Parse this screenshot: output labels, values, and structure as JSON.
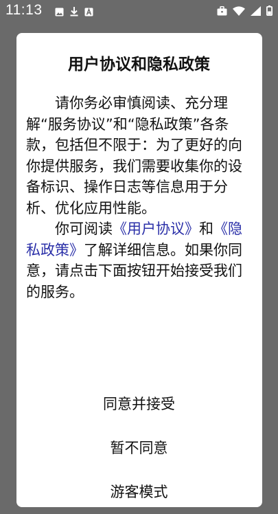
{
  "status_bar": {
    "time": "11:13",
    "notification_icons": [
      "image-icon",
      "download-icon",
      "a-badge-icon"
    ],
    "system_icons": [
      "briefcase-icon",
      "wifi-icon",
      "signal-icon",
      "battery-icon"
    ]
  },
  "dialog": {
    "title": "用户协议和隐私政策",
    "paragraph1": "请你务必审慎阅读、充分理解“服务协议”和“隐私政策”各条款，包括但不限于：为了更好的向你提供服务，我们需要收集你的设备标识、操作日志等信息用于分析、优化应用性能。",
    "paragraph2_prefix": "你可阅读",
    "user_agreement_link": "《用户协议》",
    "paragraph2_and": "和",
    "privacy_policy_link": "《隐私政策》",
    "paragraph2_suffix": "了解详细信息。如果你同意，请点击下面按钮开始接受我们的服务。",
    "agree_label": "同意并接受",
    "disagree_label": "暂不同意",
    "guest_label": "游客模式"
  },
  "colors": {
    "link": "#2a2fa8",
    "scrim": "#6a6a6a",
    "dialog_bg": "#ffffff"
  }
}
